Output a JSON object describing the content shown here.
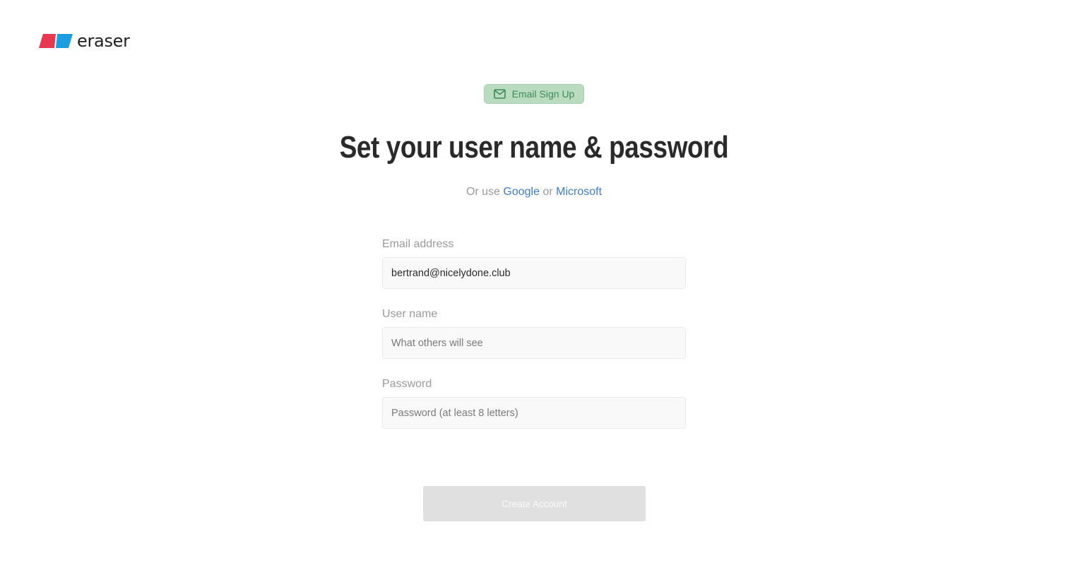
{
  "brand": {
    "name": "eraser",
    "colors": {
      "left": "#e8384f",
      "right": "#1b9de2"
    }
  },
  "badge": {
    "icon": "mail-icon",
    "label": "Email Sign Up",
    "color": "#3f8a55"
  },
  "heading": "Set your user name & password",
  "alternatives": {
    "prefix": "Or use",
    "google": "Google",
    "separator": "or",
    "microsoft": "Microsoft",
    "link_color": "#3d7bd9"
  },
  "form": {
    "email": {
      "label": "Email address",
      "value": "bertrand@nicelydone.club"
    },
    "username": {
      "label": "User name",
      "placeholder": "What others will see",
      "value": ""
    },
    "password": {
      "label": "Password",
      "placeholder": "Password (at least 8 letters)",
      "value": ""
    },
    "submit_label": "Create Account"
  }
}
